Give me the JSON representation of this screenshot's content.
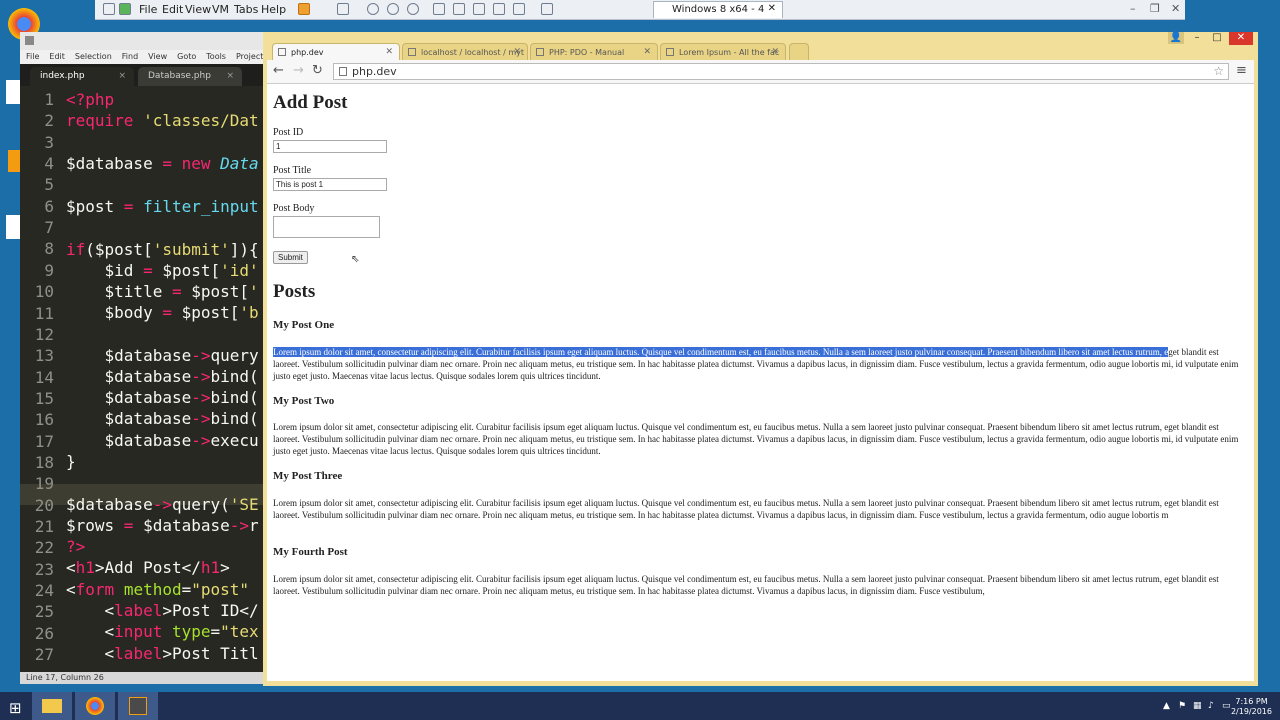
{
  "vm": {
    "menus": [
      "File",
      "Edit",
      "View",
      "VM",
      "Tabs",
      "Help"
    ],
    "tab_title": "Windows 8 x64 - 4"
  },
  "sublime": {
    "menus": [
      "File",
      "Edit",
      "Selection",
      "Find",
      "View",
      "Goto",
      "Tools",
      "Project",
      "Pr"
    ],
    "tabs": [
      "index.php",
      "Database.php"
    ],
    "status": "Line 17, Column 26",
    "line_numbers": [
      "1",
      "2",
      "3",
      "4",
      "5",
      "6",
      "7",
      "8",
      "9",
      "10",
      "11",
      "12",
      "13",
      "14",
      "15",
      "16",
      "17",
      "18",
      "19",
      "20",
      "21",
      "22",
      "23",
      "24",
      "25",
      "26",
      "27"
    ]
  },
  "chrome": {
    "tabs": [
      {
        "label": "php.dev"
      },
      {
        "label": "localhost / localhost / myt"
      },
      {
        "label": "PHP: PDO - Manual"
      },
      {
        "label": "Lorem Ipsum - All the fac"
      }
    ],
    "url": "php.dev"
  },
  "page": {
    "title": "Add Post",
    "form": {
      "post_id_label": "Post ID",
      "post_id_value": "1",
      "post_title_label": "Post Title",
      "post_title_value": "This is post 1",
      "post_body_label": "Post Body",
      "submit_label": "Submit"
    },
    "posts_heading": "Posts",
    "lorem_highlight": "Lorem ipsum dolor sit amet, consectetur adipiscing elit. Curabitur facilisis ipsum eget aliquam luctus. Quisque vel condimentum est, eu faucibus metus. Nulla a sem laoreet justo pulvinar consequat. Praesent bibendum libero sit amet lectus rutrum, e",
    "lorem_rest_1": "get blandit est laoreet. Vestibulum sollicitudin pulvinar diam nec ornare. Proin nec aliquam metus, eu tristique sem. In hac habitasse platea dictumst. Vivamus a dapibus lacus, in dignissim diam. Fusce vestibulum, lectus a gravida fermentum, odio augue lobortis mi, id vulputate enim justo eget justo. Maecenas vitae lacus lectus. Quisque sodales lorem quis ultrices tincidunt.",
    "posts": [
      {
        "title": "My Post One"
      },
      {
        "title": "My Post Two",
        "body": "Lorem ipsum dolor sit amet, consectetur adipiscing elit. Curabitur facilisis ipsum eget aliquam luctus. Quisque vel condimentum est, eu faucibus metus. Nulla a sem laoreet justo pulvinar consequat. Praesent bibendum libero sit amet lectus rutrum, eget blandit est laoreet. Vestibulum sollicitudin pulvinar diam nec ornare. Proin nec aliquam metus, eu tristique sem. In hac habitasse platea dictumst. Vivamus a dapibus lacus, in dignissim diam. Fusce vestibulum, lectus a gravida fermentum, odio augue lobortis mi, id vulputate enim justo eget justo. Maecenas vitae lacus lectus. Quisque sodales lorem quis ultrices tincidunt."
      },
      {
        "title": "My Post Three",
        "body": "Lorem ipsum dolor sit amet, consectetur adipiscing elit. Curabitur facilisis ipsum eget aliquam luctus. Quisque vel condimentum est, eu faucibus metus. Nulla a sem laoreet justo pulvinar consequat. Praesent bibendum libero sit amet lectus rutrum, eget blandit est laoreet. Vestibulum sollicitudin pulvinar diam nec ornare. Proin nec aliquam metus, eu tristique sem. In hac habitasse platea dictumst. Vivamus a dapibus lacus, in dignissim diam. Fusce vestibulum, lectus a gravida fermentum, odio augue lobortis m"
      },
      {
        "title": "My Fourth Post",
        "body": "Lorem ipsum dolor sit amet, consectetur adipiscing elit. Curabitur facilisis ipsum eget aliquam luctus. Quisque vel condimentum est, eu faucibus metus. Nulla a sem laoreet justo pulvinar consequat. Praesent bibendum libero sit amet lectus rutrum, eget blandit est laoreet. Vestibulum sollicitudin pulvinar diam nec ornare. Proin nec aliquam metus, eu tristique sem. In hac habitasse platea dictumst. Vivamus a dapibus lacus, in dignissim diam. Fusce vestibulum,"
      }
    ]
  },
  "taskbar": {
    "time": "7:16 PM",
    "date": "2/19/2016"
  },
  "colors": {
    "editor_bg": "#272822",
    "chrome_frame": "#f2e09a",
    "selection": "#3a6fd8",
    "taskbar": "#1e2f53"
  }
}
